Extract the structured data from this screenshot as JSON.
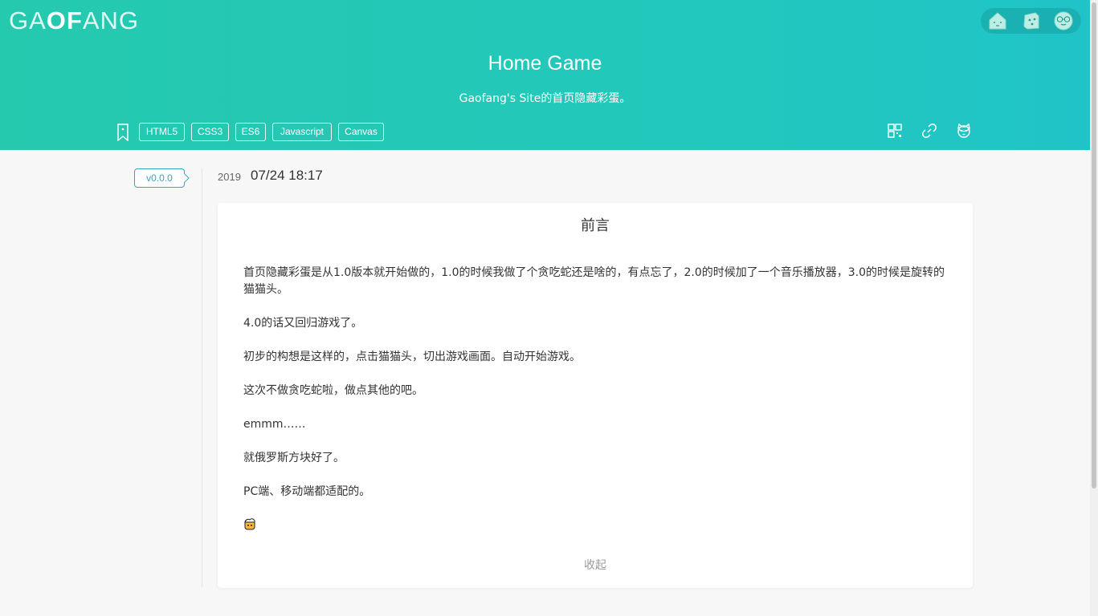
{
  "header": {
    "logo": {
      "part1": "GA",
      "part2": "OF",
      "part3": "ANG"
    },
    "title": "Home Game",
    "subtitle": "Gaofang's Site的首页隐藏彩蛋。",
    "top_icons": [
      "home-icon",
      "dice-icon",
      "glasses-face-icon"
    ],
    "tags": [
      "HTML5",
      "CSS3",
      "ES6",
      "Javascript",
      "Canvas"
    ],
    "tools": [
      "qrcode-icon",
      "link-icon",
      "cat-face-icon"
    ]
  },
  "post": {
    "version": "v0.0.0",
    "year": "2019",
    "datetime": "07/24 18:17",
    "title": "前言",
    "paragraphs": [
      "首页隐藏彩蛋是从1.0版本就开始做的，1.0的时候我做了个贪吃蛇还是啥的，有点忘了，2.0的时候加了一个音乐播放器，3.0的时候是旋转的猫猫头。",
      "4.0的话又回归游戏了。",
      "初步的构想是这样的，点击猫猫头，切出游戏画面。自动开始游戏。",
      "这次不做贪吃蛇啦，做点其他的吧。",
      "emmm……",
      "就俄罗斯方块好了。",
      "PC端、移动端都适配的。"
    ],
    "emoji": "beer-emoji",
    "collapse_label": "收起"
  },
  "colors": {
    "header_start": "#25c9ae",
    "header_end": "#20c4c8",
    "accent": "#33a6c4"
  }
}
